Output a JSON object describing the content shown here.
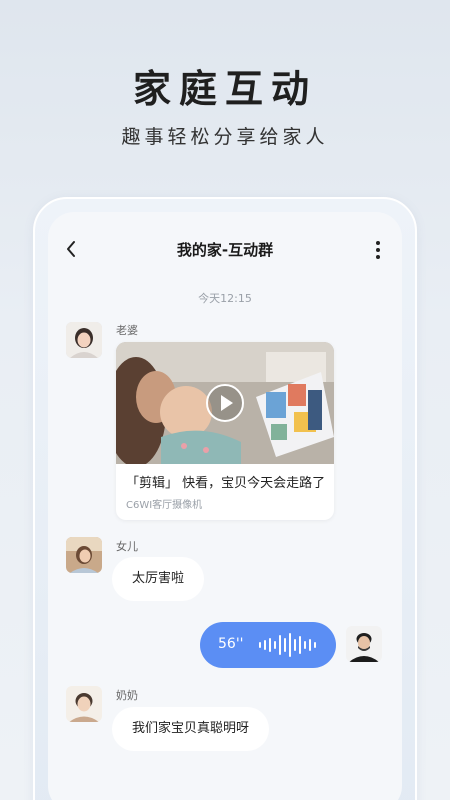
{
  "promo": {
    "title": "家庭互动",
    "subtitle": "趣事轻松分享给家人"
  },
  "nav": {
    "back_icon": "chevron-left-icon",
    "title": "我的家-互动群",
    "more_icon": "vertical-ellipsis-icon"
  },
  "chat": {
    "timestamp": "今天12:15",
    "messages": [
      {
        "sender": "老婆",
        "type": "video",
        "caption": "「剪辑」 快看，宝贝今天会走路了",
        "source": "C6WI客厅摄像机",
        "play_icon": "play-icon"
      },
      {
        "sender": "女儿",
        "type": "text",
        "text": "太厉害啦"
      },
      {
        "sender": "me",
        "type": "voice",
        "duration": "56''",
        "wave_icon": "voice-waveform-icon",
        "color": "#5b8ef4"
      },
      {
        "sender": "奶奶",
        "type": "text",
        "text": "我们家宝贝真聪明呀"
      }
    ]
  },
  "colors": {
    "accent": "#5b8ef4",
    "background": "#f5f7fa"
  }
}
